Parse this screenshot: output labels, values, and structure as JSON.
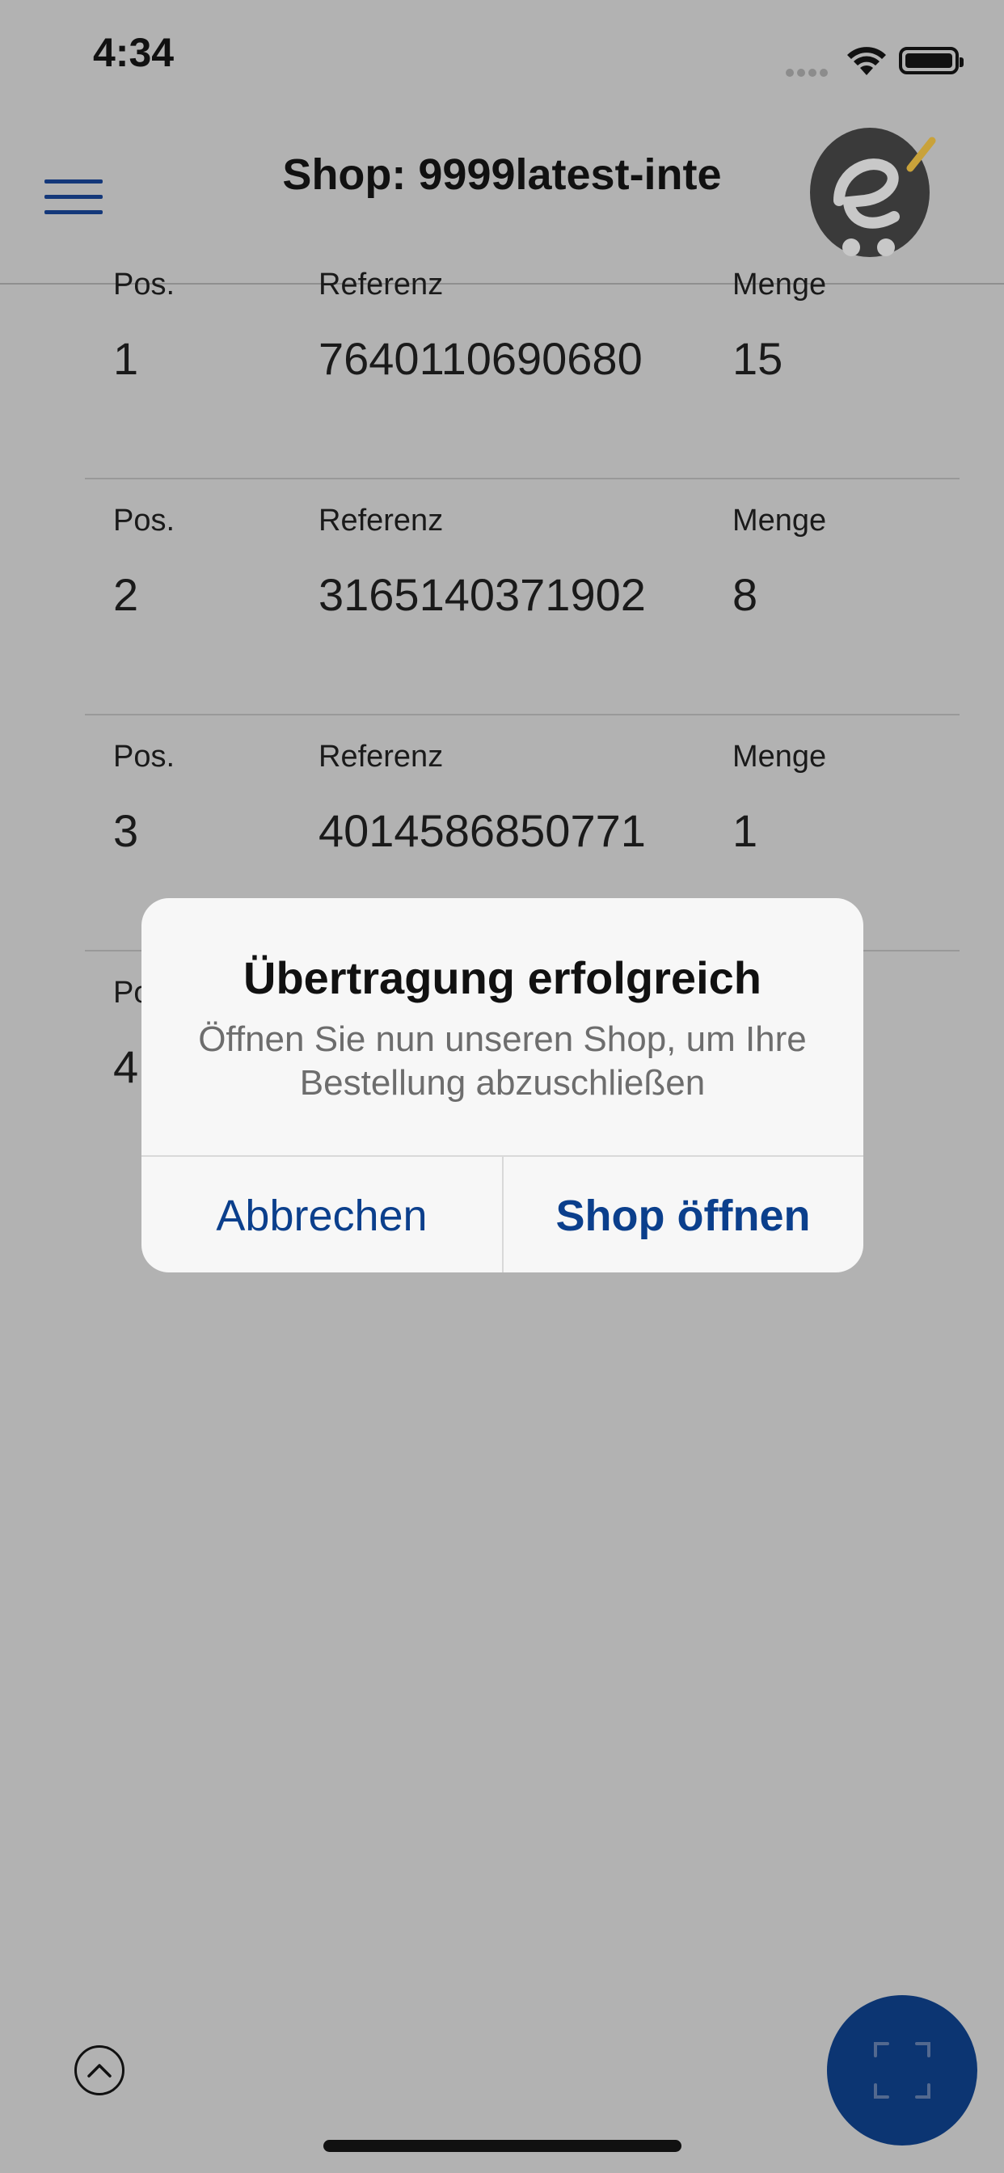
{
  "status_bar": {
    "time": "4:34"
  },
  "header": {
    "title": "Shop: 9999latest-inte"
  },
  "table": {
    "rows": [
      {
        "pos_label": "Pos.",
        "ref_label": "Referenz",
        "qty_label": "Menge",
        "pos": "1",
        "ref": "7640110690680",
        "qty": "15"
      },
      {
        "pos_label": "Pos.",
        "ref_label": "Referenz",
        "qty_label": "Menge",
        "pos": "2",
        "ref": "3165140371902",
        "qty": "8"
      },
      {
        "pos_label": "Pos.",
        "ref_label": "Referenz",
        "qty_label": "Menge",
        "pos": "3",
        "ref": "4014586850771",
        "qty": "1"
      },
      {
        "pos_label": "Po",
        "ref_label": "",
        "qty_label": "",
        "pos": "4",
        "ref": "",
        "qty": ""
      }
    ]
  },
  "dialog": {
    "title": "Übertragung erfolgreich",
    "message": "Öffnen Sie nun unseren Shop, um Ihre Bestellung abzuschließen",
    "cancel_label": "Abbrechen",
    "confirm_label": "Shop öffnen"
  },
  "colors": {
    "accent": "#0b3f8c",
    "fab": "#0c3572",
    "overlay_bg": "#b2b2b2"
  },
  "icons": {
    "menu": "hamburger-icon",
    "scroll_top": "chevron-up-icon",
    "scan": "scan-frame-icon",
    "logo": "eshop-cart-logo"
  }
}
